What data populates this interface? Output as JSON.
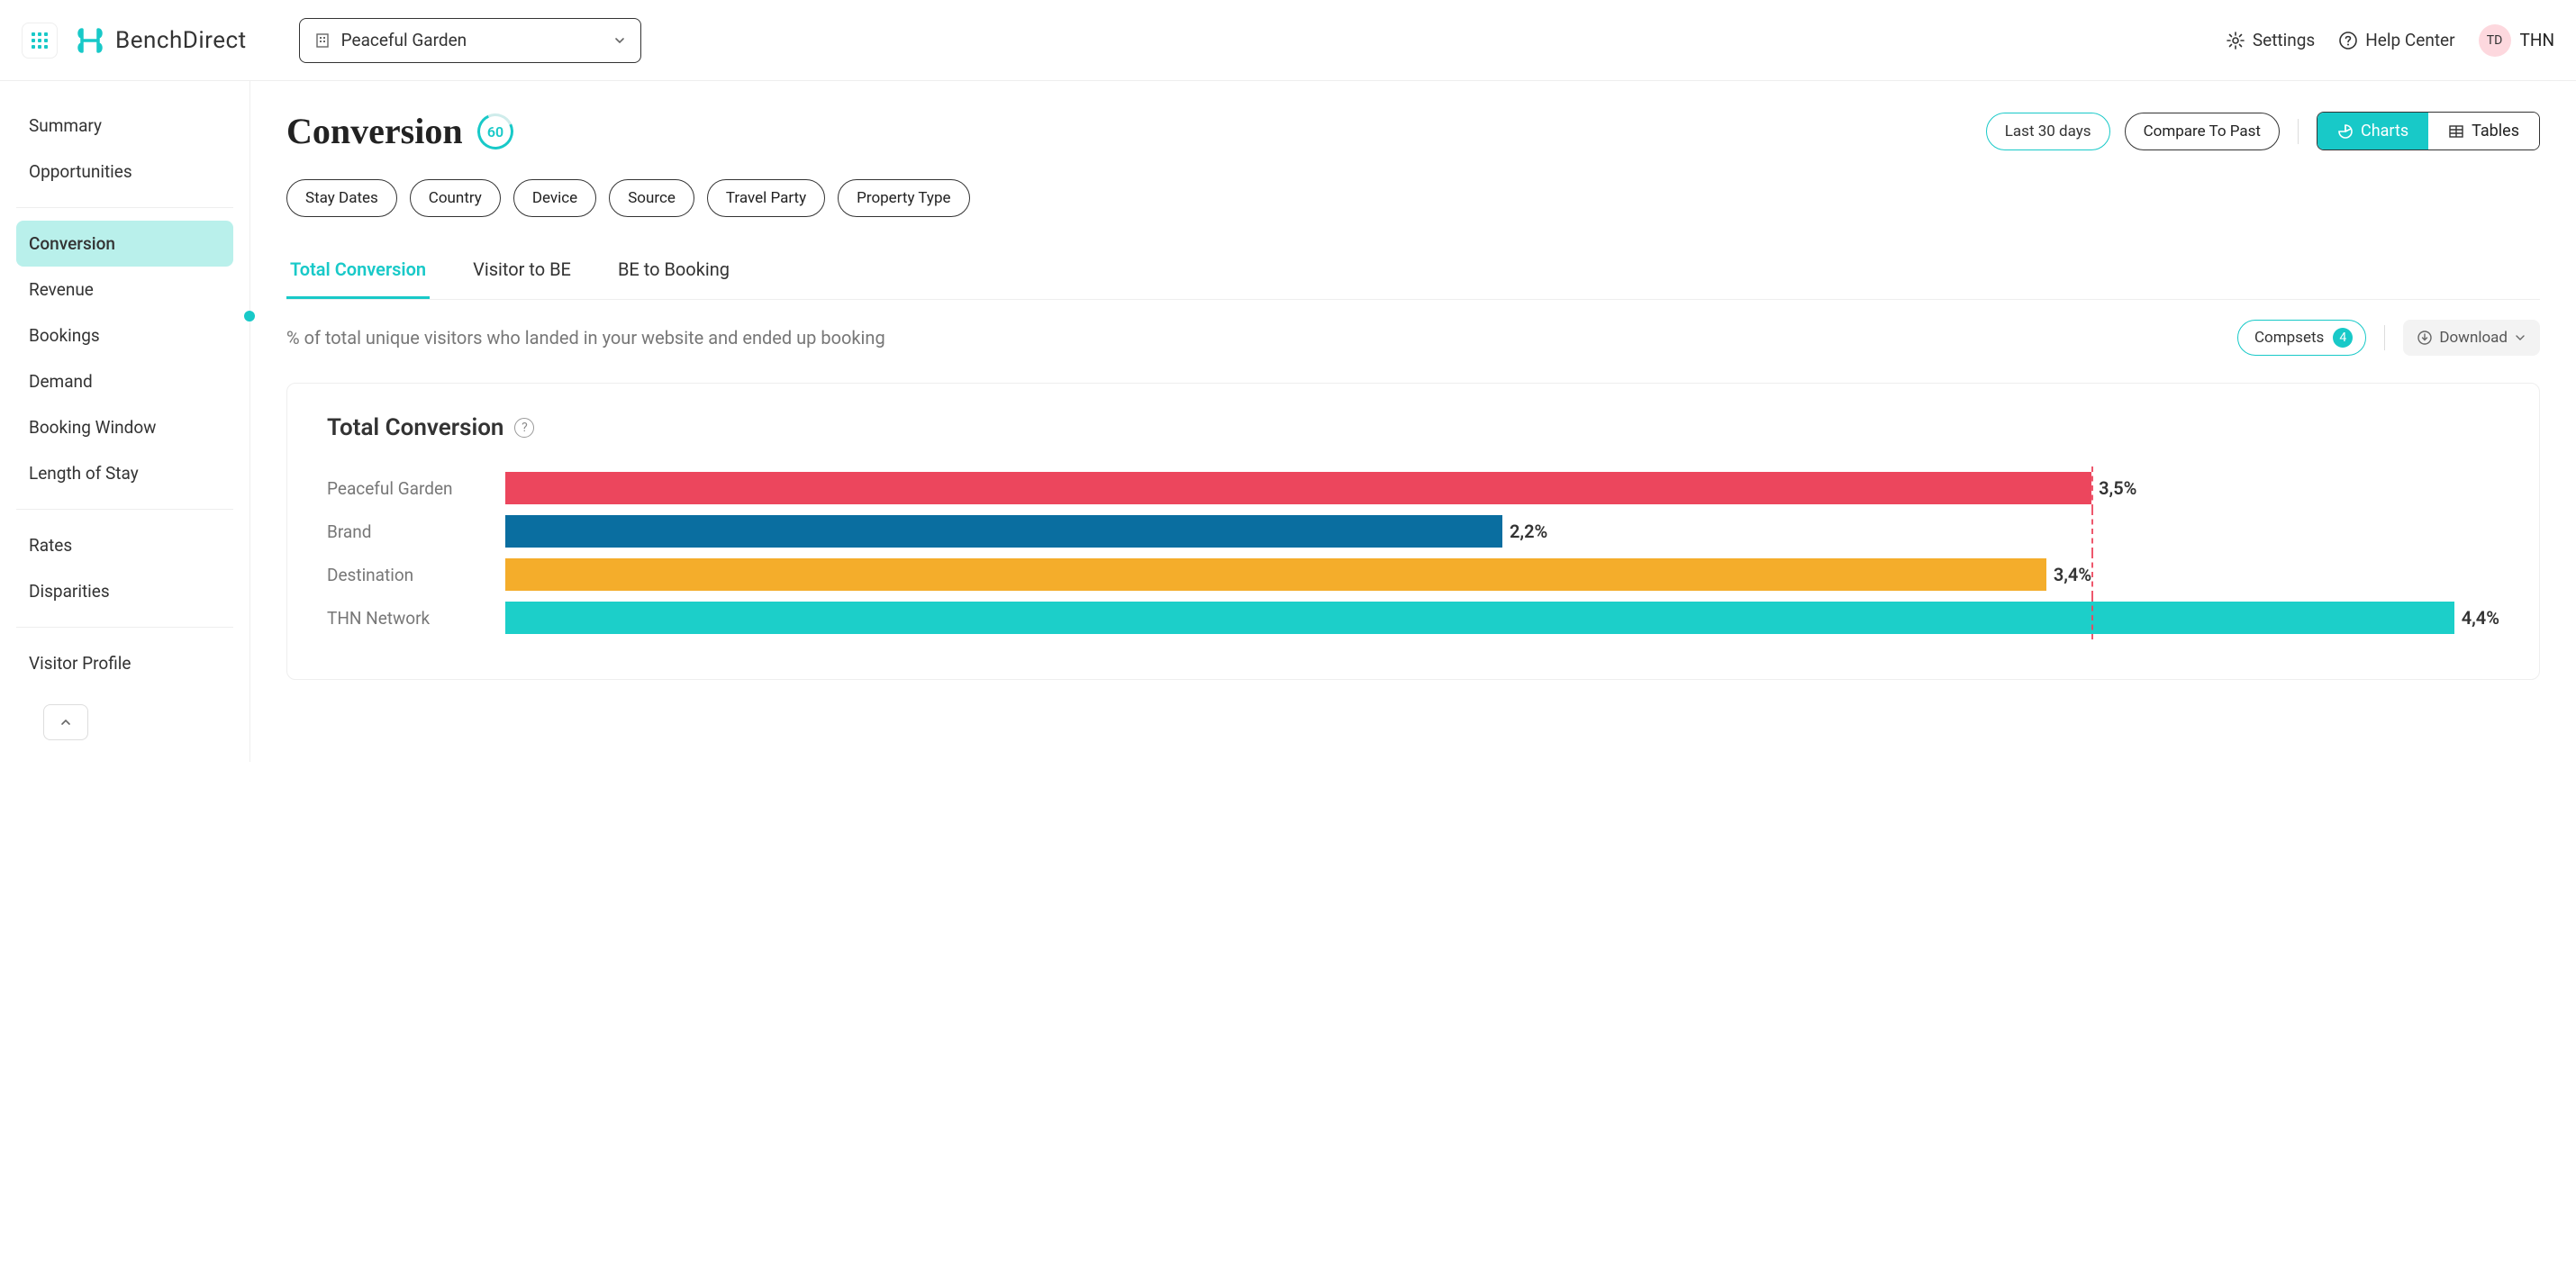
{
  "brand": {
    "name": "BenchDirect"
  },
  "property_selector": {
    "label": "Peaceful Garden"
  },
  "top_links": {
    "settings": "Settings",
    "help": "Help Center"
  },
  "user": {
    "initials": "TD",
    "name": "THN"
  },
  "sidebar": {
    "items": [
      "Summary",
      "Opportunities",
      "Conversion",
      "Revenue",
      "Bookings",
      "Demand",
      "Booking Window",
      "Length of Stay",
      "Rates",
      "Disparities",
      "Visitor Profile"
    ],
    "active": "Conversion"
  },
  "page": {
    "title": "Conversion",
    "score": "60"
  },
  "header_actions": {
    "date_range": "Last 30 days",
    "compare": "Compare To Past",
    "view_charts": "Charts",
    "view_tables": "Tables"
  },
  "filters": [
    "Stay Dates",
    "Country",
    "Device",
    "Source",
    "Travel Party",
    "Property Type"
  ],
  "tabs": {
    "items": [
      "Total Conversion",
      "Visitor to BE",
      "BE to Booking"
    ],
    "active": "Total Conversion"
  },
  "description": "% of total unique visitors who landed in your website and ended up booking",
  "compsets": {
    "label": "Compsets",
    "count": "4"
  },
  "download": "Download",
  "card": {
    "title": "Total Conversion"
  },
  "chart_data": {
    "type": "bar",
    "title": "Total Conversion",
    "xlabel": "",
    "ylabel": "",
    "ylim": [
      0,
      4.4
    ],
    "reference_line": 3.5,
    "categories": [
      "Peaceful Garden",
      "Brand",
      "Destination",
      "THN Network"
    ],
    "series": [
      {
        "name": "Total Conversion %",
        "values": [
          3.5,
          2.2,
          3.4,
          4.4
        ],
        "labels": [
          "3,5%",
          "2,2%",
          "3,4%",
          "4,4%"
        ],
        "colors": [
          "#ec465d",
          "#0a6ea0",
          "#f4ad2b",
          "#1ccfc9"
        ]
      }
    ]
  }
}
